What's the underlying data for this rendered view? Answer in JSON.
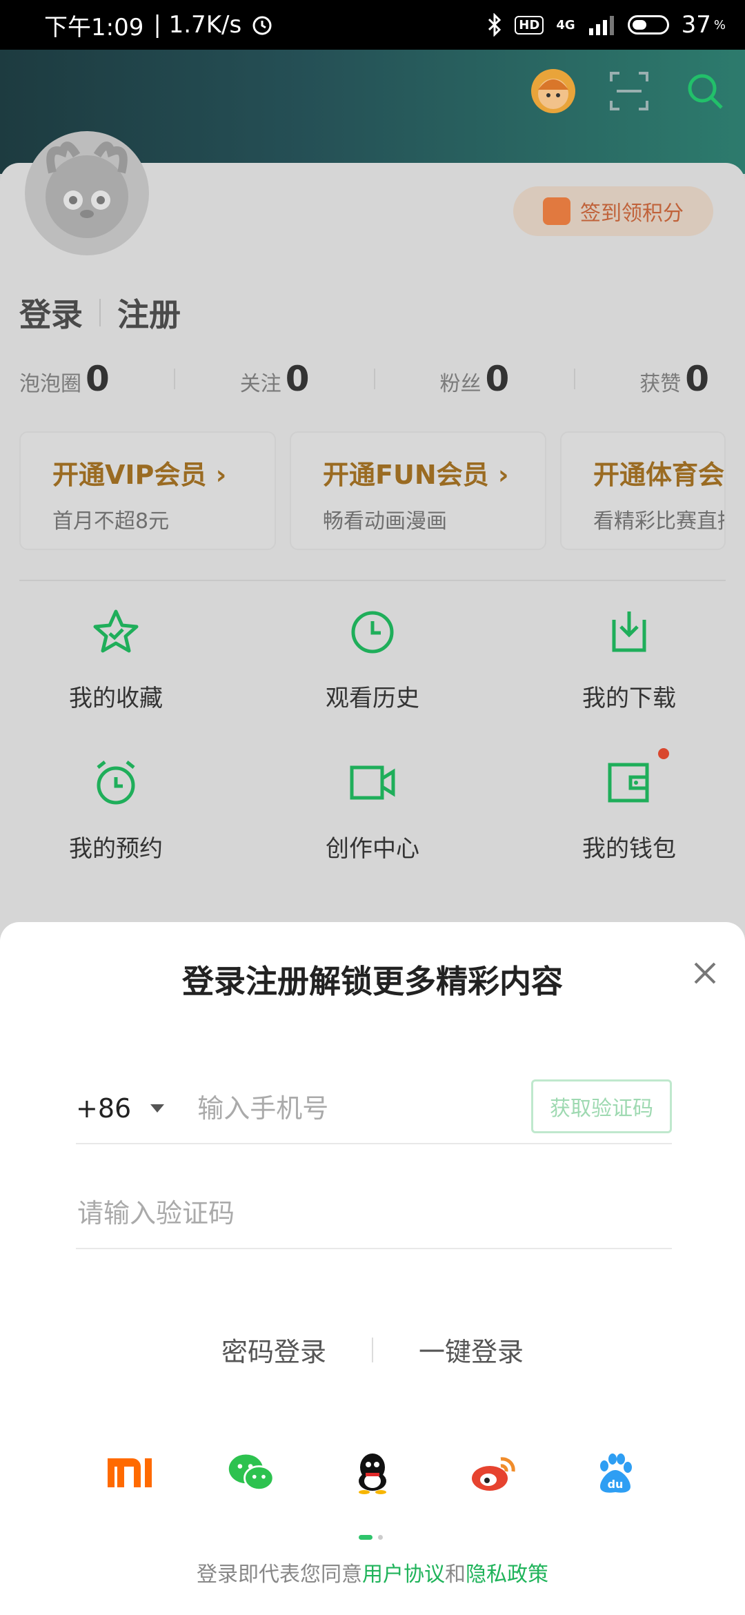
{
  "status_bar": {
    "time": "下午1:09",
    "net_speed": "| 1.7K/s",
    "hd": "HD",
    "network": "4G",
    "battery": "37",
    "battery_unit": "%"
  },
  "profile": {
    "checkin_label": "签到领积分",
    "login": "登录",
    "register": "注册",
    "stats": [
      {
        "label": "泡泡圈",
        "value": "0"
      },
      {
        "label": "关注",
        "value": "0"
      },
      {
        "label": "粉丝",
        "value": "0"
      },
      {
        "label": "获赞",
        "value": "0"
      }
    ]
  },
  "vip_cards": [
    {
      "title": "开通VIP会员 ›",
      "subtitle": "首月不超8元"
    },
    {
      "title": "开通FUN会员 ›",
      "subtitle": "畅看动画漫画"
    },
    {
      "title": "开通体育会员",
      "subtitle": "看精彩比赛直播"
    }
  ],
  "grid": [
    {
      "label": "我的收藏",
      "icon": "star-icon"
    },
    {
      "label": "观看历史",
      "icon": "clock-icon"
    },
    {
      "label": "我的下载",
      "icon": "download-icon"
    },
    {
      "label": "我的预约",
      "icon": "alarm-icon"
    },
    {
      "label": "创作中心",
      "icon": "video-camera-icon"
    },
    {
      "label": "我的钱包",
      "icon": "wallet-icon"
    }
  ],
  "login_sheet": {
    "title": "登录注册解锁更多精彩内容",
    "country_code": "+86",
    "phone_placeholder": "输入手机号",
    "get_code": "获取验证码",
    "code_placeholder": "请输入验证码",
    "password_login": "密码登录",
    "one_click_login": "一键登录",
    "social": [
      "xiaomi-icon",
      "wechat-icon",
      "qq-icon",
      "weibo-icon",
      "baidu-icon"
    ],
    "terms_prefix": "登录即代表您同意",
    "user_agreement": "用户协议",
    "and": "和",
    "privacy_policy": "隐私政策"
  },
  "colors": {
    "accent_green": "#1fb35a",
    "vip_gold": "#9a6b22",
    "checkin_orange": "#c0623a"
  }
}
